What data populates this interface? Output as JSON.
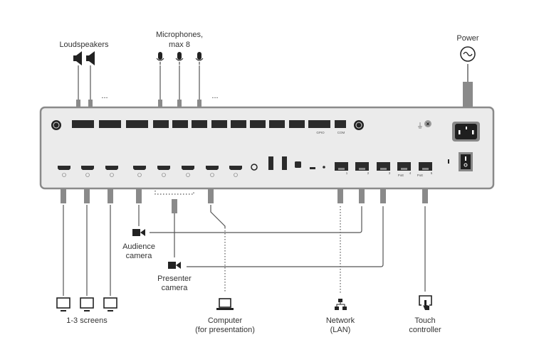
{
  "labels": {
    "loudspeakers": "Loudspeakers",
    "microphones_1": "Microphones,",
    "microphones_2": "max 8",
    "power": "Power",
    "screens": "1-3 screens",
    "audience_1": "Audience",
    "audience_2": "camera",
    "presenter_1": "Presenter",
    "presenter_2": "camera",
    "computer_1": "Computer",
    "computer_2": "(for presentation)",
    "network_1": "Network",
    "network_2": "(LAN)",
    "touch_1": "Touch",
    "touch_2": "controller",
    "more": "..."
  },
  "panel": {
    "gpio": "GPIO",
    "com": "COM",
    "poe_4": "PoE",
    "poe_5": "PoE",
    "lan_ports": [
      "1",
      "2",
      "3",
      "4",
      "5"
    ]
  },
  "colors": {
    "panel_fill": "#ebebeb",
    "panel_stroke": "#8a8a8a",
    "port": "#2b2b2b",
    "cable": "#555555"
  }
}
